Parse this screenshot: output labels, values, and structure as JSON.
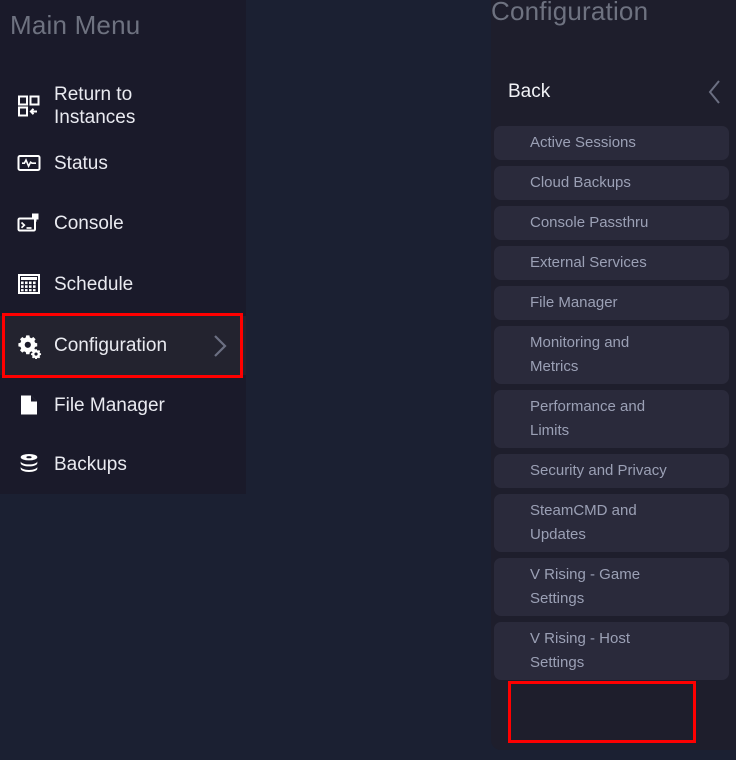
{
  "colors": {
    "app_background": "#1b2032",
    "sidebar_background": "#1a1a2a",
    "panel_background": "#1e1e2c",
    "button_background": "#2a2a3b",
    "active_row_background": "#23232f",
    "heading_text": "#6e7280",
    "primary_text": "#e9eaf0",
    "muted_text": "#9ba0b5",
    "highlight_outline": "#ff0000"
  },
  "sidebar": {
    "title": "Main Menu",
    "items": [
      {
        "label": "Return to\nInstances",
        "icon": "grid-arrow-icon",
        "active": false,
        "has_chevron": false
      },
      {
        "label": "Status",
        "icon": "monitor-pulse-icon",
        "active": false,
        "has_chevron": false
      },
      {
        "label": "Console",
        "icon": "terminal-icon",
        "active": false,
        "has_chevron": false
      },
      {
        "label": "Schedule",
        "icon": "calendar-grid-icon",
        "active": false,
        "has_chevron": false
      },
      {
        "label": "Configuration",
        "icon": "gears-icon",
        "active": true,
        "has_chevron": true
      },
      {
        "label": "File Manager",
        "icon": "document-icon",
        "active": false,
        "has_chevron": false
      },
      {
        "label": "Backups",
        "icon": "database-stack-icon",
        "active": false,
        "has_chevron": false
      }
    ]
  },
  "config_panel": {
    "title": "Configuration",
    "back_label": "Back",
    "back_icon": "chevron-left-icon",
    "items": [
      {
        "label": "Active Sessions"
      },
      {
        "label": "Cloud Backups"
      },
      {
        "label": "Console Passthru"
      },
      {
        "label": "External Services"
      },
      {
        "label": "File Manager"
      },
      {
        "label": "Monitoring and\nMetrics"
      },
      {
        "label": "Performance and\nLimits"
      },
      {
        "label": "Security and Privacy"
      },
      {
        "label": "SteamCMD and\nUpdates"
      },
      {
        "label": "V Rising - Game\nSettings"
      },
      {
        "label": "V Rising - Host\nSettings"
      }
    ]
  },
  "annotations": [
    {
      "name": "configuration-highlight",
      "target": "Configuration"
    },
    {
      "name": "v-rising-host-settings-highlight",
      "target": "V Rising - Host Settings"
    }
  ]
}
